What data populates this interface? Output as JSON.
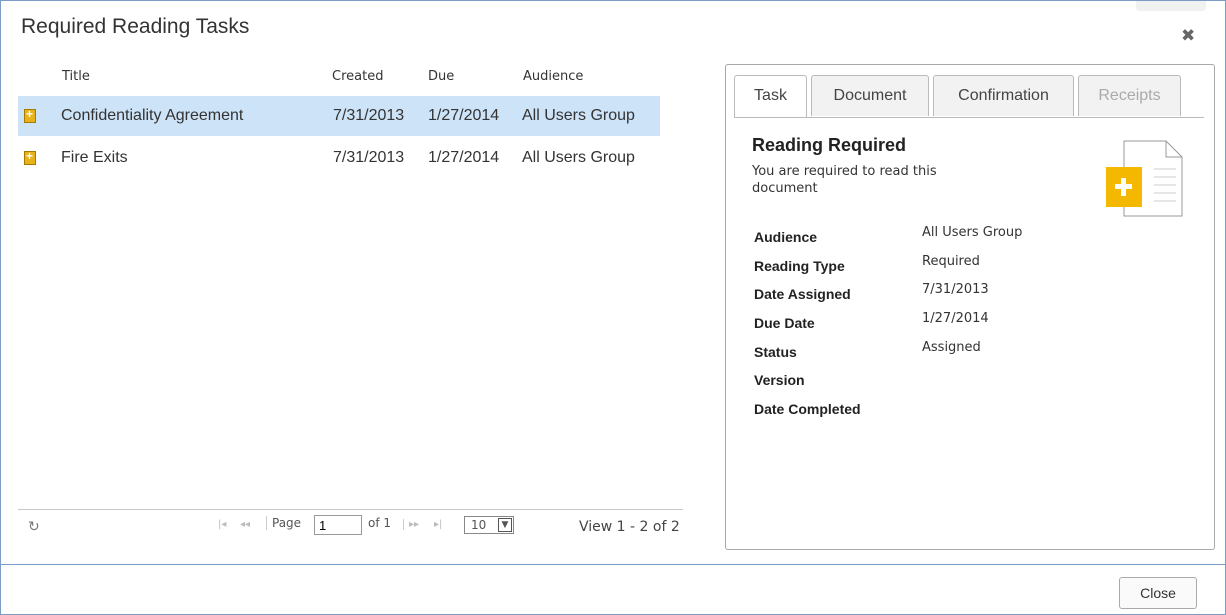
{
  "dialog": {
    "title": "Required Reading Tasks",
    "close_label": "Close"
  },
  "grid": {
    "columns": {
      "title": "Title",
      "created": "Created",
      "due": "Due",
      "audience": "Audience"
    },
    "rows": [
      {
        "title": "Confidentiality Agreement",
        "created": "7/31/2013",
        "due": "1/27/2014",
        "audience": "All Users Group"
      },
      {
        "title": "Fire Exits",
        "created": "7/31/2013",
        "due": "1/27/2014",
        "audience": "All Users Group"
      }
    ],
    "selected_index": 0
  },
  "pager": {
    "page_label": "Page",
    "page_value": "1",
    "of_label": "of 1",
    "page_size": "10",
    "view_text": "View 1 - 2 of 2"
  },
  "tabs": [
    {
      "label": "Task"
    },
    {
      "label": "Document"
    },
    {
      "label": "Confirmation"
    },
    {
      "label": "Receipts"
    }
  ],
  "task": {
    "heading": "Reading Required",
    "description": "You are required to read this document",
    "fields": [
      {
        "label": "Audience",
        "value": "All Users Group"
      },
      {
        "label": "Reading Type",
        "value": "Required"
      },
      {
        "label": "Date Assigned",
        "value": "7/31/2013"
      },
      {
        "label": "Due Date",
        "value": "1/27/2014"
      },
      {
        "label": "Status",
        "value": "Assigned"
      },
      {
        "label": "Version",
        "value": ""
      },
      {
        "label": "Date Completed",
        "value": ""
      }
    ]
  },
  "colors": {
    "selected_row": "#cde3f7",
    "dialog_border": "#7a9cc6",
    "doc_accent": "#f5b800"
  },
  "icons": {
    "close": "close-icon",
    "refresh": "refresh-icon",
    "row_doc": "document-plus-icon"
  }
}
